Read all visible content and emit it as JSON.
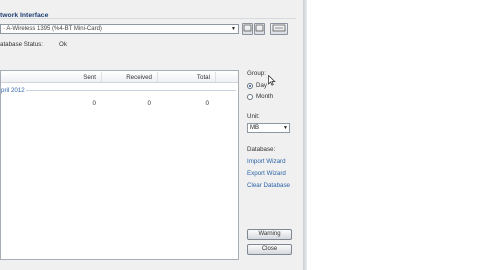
{
  "window": {
    "group_title": "twork Interface",
    "adapter_value": "· A-Wireless 1395 (%4-BT Mini-Card)",
    "database_status_label": "atabase Status:",
    "database_status_value": "Ok"
  },
  "toolbar": {
    "btn1": "□",
    "btn2": "□",
    "btn3": "□"
  },
  "grid": {
    "columns": [
      "Sent",
      "Received",
      "Total"
    ],
    "period": "pril 2012",
    "rows": [
      {
        "sent": "0",
        "received": "0",
        "total": "0"
      }
    ]
  },
  "sidebar": {
    "group_label": "Group:",
    "group_options": [
      "Day",
      "Month"
    ],
    "group_selected": "Day",
    "unit_label": "Unit:",
    "unit_value": "MB",
    "database_label": "Database:",
    "links": [
      "Import Wizard",
      "Export Wizard",
      "Clear Database"
    ],
    "buttons": [
      "Warning",
      "Close"
    ]
  }
}
